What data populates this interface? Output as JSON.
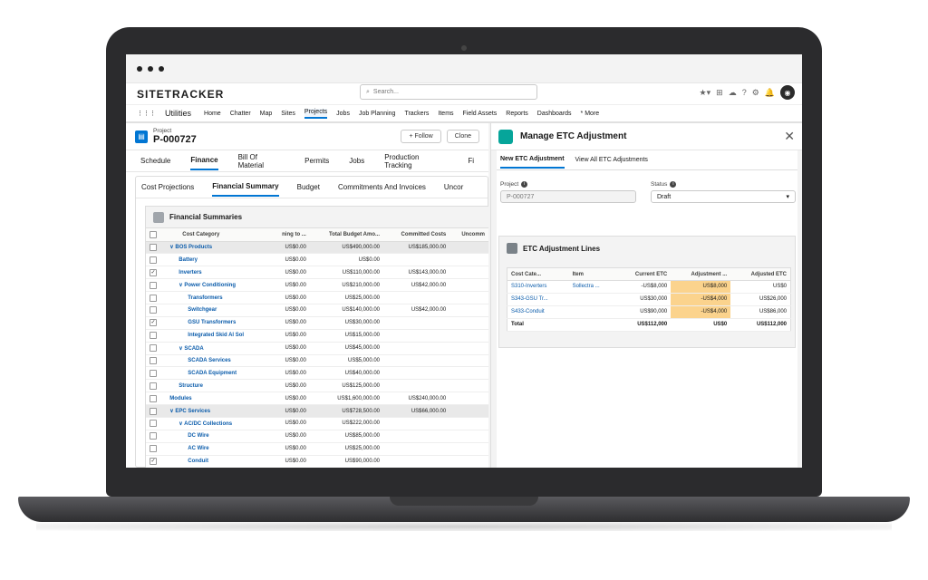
{
  "header": {
    "logo": "SITETRACKER",
    "search_placeholder": "Search..."
  },
  "nav": {
    "app_name": "Utilities",
    "items": [
      "Home",
      "Chatter",
      "Map",
      "Sites",
      "Projects",
      "Jobs",
      "Job Planning",
      "Trackers",
      "Items",
      "Field Assets",
      "Reports",
      "Dashboards",
      "* More"
    ]
  },
  "record": {
    "type": "Project",
    "id": "P-000727",
    "follow": "+ Follow",
    "clone": "Clone"
  },
  "record_tabs": [
    "Schedule",
    "Finance",
    "Bill Of Material",
    "Permits",
    "Jobs",
    "Production Tracking",
    "Fi"
  ],
  "finance_tabs": [
    "Cost Projections",
    "Financial Summary",
    "Budget",
    "Commitments And Invoices",
    "Uncor"
  ],
  "financial_summaries": {
    "title": "Financial Summaries",
    "columns": [
      "Cost Category",
      "ning to ...",
      "Total Budget Amo...",
      "Committed Costs",
      "Uncomm"
    ],
    "rows": [
      {
        "name": "∨ BOS Products",
        "r": "US$0.00",
        "b": "US$490,000.00",
        "c": "US$185,000.00",
        "checked": "",
        "indent": "0"
      },
      {
        "name": "Battery",
        "r": "US$0.00",
        "b": "US$0.00",
        "c": "",
        "checked": "",
        "indent": "1"
      },
      {
        "name": "Inverters",
        "r": "US$0.00",
        "b": "US$110,000.00",
        "c": "US$143,000.00",
        "checked": "✓",
        "indent": "1"
      },
      {
        "name": "∨ Power Conditioning",
        "r": "US$0.00",
        "b": "US$210,000.00",
        "c": "US$42,000.00",
        "checked": "",
        "indent": "1"
      },
      {
        "name": "Transformers",
        "r": "US$0.00",
        "b": "US$25,000.00",
        "c": "",
        "checked": "",
        "indent": "2"
      },
      {
        "name": "Switchgear",
        "r": "US$0.00",
        "b": "US$140,000.00",
        "c": "US$42,000.00",
        "checked": "",
        "indent": "2"
      },
      {
        "name": "GSU Transformers",
        "r": "US$0.00",
        "b": "US$30,000.00",
        "c": "",
        "checked": "✓",
        "indent": "2"
      },
      {
        "name": "Integrated Skid Al Sol",
        "r": "US$0.00",
        "b": "US$15,000.00",
        "c": "",
        "checked": "",
        "indent": "2"
      },
      {
        "name": "∨ SCADA",
        "r": "US$0.00",
        "b": "US$45,000.00",
        "c": "",
        "checked": "",
        "indent": "1"
      },
      {
        "name": "SCADA Services",
        "r": "US$0.00",
        "b": "US$5,000.00",
        "c": "",
        "checked": "",
        "indent": "2"
      },
      {
        "name": "SCADA Equipment",
        "r": "US$0.00",
        "b": "US$40,000.00",
        "c": "",
        "checked": "",
        "indent": "2"
      },
      {
        "name": "Structure",
        "r": "US$0.00",
        "b": "US$125,000.00",
        "c": "",
        "checked": "",
        "indent": "1"
      },
      {
        "name": "Modules",
        "r": "US$0.00",
        "b": "US$1,600,000.00",
        "c": "US$240,000.00",
        "checked": "",
        "indent": "0"
      },
      {
        "name": "∨ EPC Services",
        "r": "US$0.00",
        "b": "US$728,500.00",
        "c": "US$66,000.00",
        "checked": "",
        "indent": "0"
      },
      {
        "name": "∨ AC/DC Collections",
        "r": "US$0.00",
        "b": "US$222,000.00",
        "c": "",
        "checked": "",
        "indent": "1"
      },
      {
        "name": "DC Wire",
        "r": "US$0.00",
        "b": "US$85,000.00",
        "c": "",
        "checked": "",
        "indent": "2"
      },
      {
        "name": "AC Wire",
        "r": "US$0.00",
        "b": "US$25,000.00",
        "c": "",
        "checked": "",
        "indent": "2"
      },
      {
        "name": "Conduit",
        "r": "US$0.00",
        "b": "US$90,000.00",
        "c": "",
        "checked": "✓",
        "indent": "2"
      }
    ]
  },
  "panel": {
    "title": "Manage ETC Adjustment",
    "tabs": [
      "New ETC Adjustment",
      "View All ETC Adjustments"
    ],
    "project_label": "Project",
    "project_value": "P-000727",
    "status_label": "Status",
    "status_value": "Draft",
    "lines_title": "ETC Adjustment Lines",
    "columns": [
      "Cost Cate...",
      "Item",
      "Current ETC",
      "Adjustment ...",
      "Adjusted ETC"
    ],
    "rows": [
      {
        "cat": "S310-Inverters",
        "item": "Sollectra ...",
        "cur": "-US$8,000",
        "adj": "US$8,000",
        "res": "US$0"
      },
      {
        "cat": "S343-GSU Tr...",
        "item": "",
        "cur": "US$30,000",
        "adj": "-US$4,000",
        "res": "US$26,000"
      },
      {
        "cat": "S433-Conduit",
        "item": "",
        "cur": "US$90,000",
        "adj": "-US$4,000",
        "res": "US$86,000"
      }
    ],
    "total": {
      "label": "Total",
      "cur": "US$112,000",
      "adj": "US$0",
      "res": "US$112,000"
    }
  }
}
